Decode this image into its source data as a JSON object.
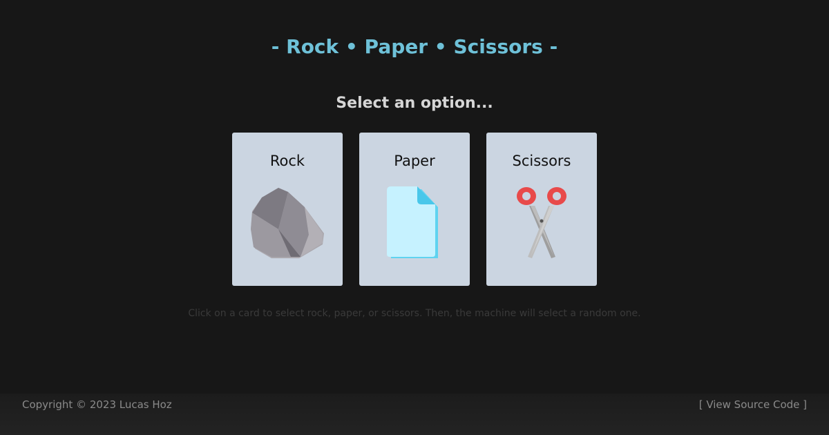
{
  "header": {
    "title": "- Rock • Paper • Scissors -",
    "prompt": "Select an option..."
  },
  "cards": [
    {
      "label": "Rock",
      "icon": "rock-icon"
    },
    {
      "label": "Paper",
      "icon": "paper-icon"
    },
    {
      "label": "Scissors",
      "icon": "scissors-icon"
    }
  ],
  "hint": "Click on a card to select rock, paper, or scissors. Then, the machine will select a random one.",
  "footer": {
    "copyright": "Copyright © 2023 Lucas Hoz",
    "source_link": "[ View Source Code ]"
  },
  "colors": {
    "background": "#171717",
    "title": "#6ec1d8",
    "card": "#cbd5e1"
  }
}
